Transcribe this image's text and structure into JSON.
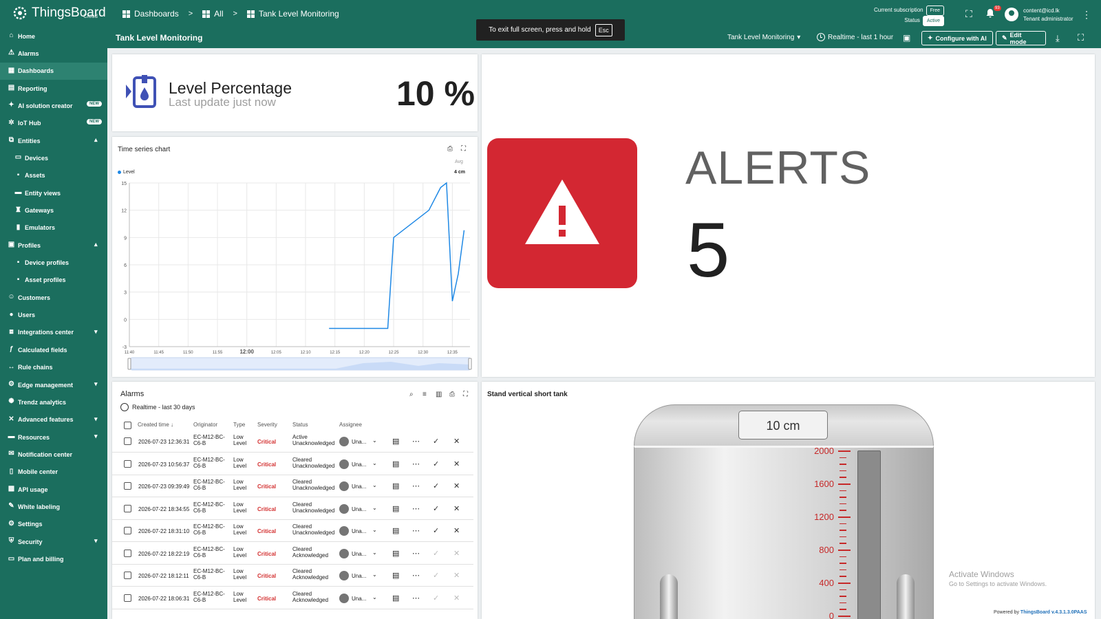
{
  "app": {
    "name": "ThingsBoard",
    "edition": "Cloud"
  },
  "breadcrumb": [
    "Dashboards",
    "All",
    "Tank Level Monitoring"
  ],
  "page_title": "Tank Level Monitoring",
  "fullscreen_hint": {
    "text": "To exit full screen, press and hold",
    "key": "Esc"
  },
  "subscription": {
    "label": "Current subscription",
    "plan": "Free",
    "status_label": "Status",
    "status": "Active"
  },
  "notifications": {
    "count": "93"
  },
  "user": {
    "email": "content@icd.lk",
    "role": "Tenant administrator"
  },
  "toolbar": {
    "dashboard_select": "Tank Level Monitoring",
    "timewindow": "Realtime - last 1 hour",
    "configure_ai": "Configure with AI",
    "edit_mode": "Edit mode"
  },
  "sidebar": {
    "items": [
      {
        "label": "Home",
        "icon": "home-icon"
      },
      {
        "label": "Alarms",
        "icon": "alarm-icon"
      },
      {
        "label": "Dashboards",
        "icon": "dashboard-icon",
        "selected": true
      },
      {
        "label": "Reporting",
        "icon": "report-icon"
      },
      {
        "label": "AI solution creator",
        "icon": "ai-icon",
        "badge": "NEW"
      },
      {
        "label": "IoT Hub",
        "icon": "hub-icon",
        "badge": "NEW"
      },
      {
        "label": "Entities",
        "icon": "entities-icon",
        "expanded": true
      },
      {
        "label": "Devices",
        "icon": "device-icon",
        "child": true
      },
      {
        "label": "Assets",
        "icon": "asset-icon",
        "child": true
      },
      {
        "label": "Entity views",
        "icon": "view-icon",
        "child": true
      },
      {
        "label": "Gateways",
        "icon": "gateway-icon",
        "child": true
      },
      {
        "label": "Emulators",
        "icon": "emulator-icon",
        "child": true
      },
      {
        "label": "Profiles",
        "icon": "profiles-icon",
        "expanded": true
      },
      {
        "label": "Device profiles",
        "icon": "device-profile-icon",
        "child": true
      },
      {
        "label": "Asset profiles",
        "icon": "asset-profile-icon",
        "child": true
      },
      {
        "label": "Customers",
        "icon": "customers-icon"
      },
      {
        "label": "Users",
        "icon": "users-icon"
      },
      {
        "label": "Integrations center",
        "icon": "integrations-icon",
        "collapsed": true
      },
      {
        "label": "Calculated fields",
        "icon": "function-icon"
      },
      {
        "label": "Rule chains",
        "icon": "rule-chain-icon"
      },
      {
        "label": "Edge management",
        "icon": "edge-icon",
        "collapsed": true
      },
      {
        "label": "Trendz analytics",
        "icon": "trendz-icon"
      },
      {
        "label": "Advanced features",
        "icon": "tools-icon",
        "collapsed": true
      },
      {
        "label": "Resources",
        "icon": "folder-icon",
        "collapsed": true
      },
      {
        "label": "Notification center",
        "icon": "inbox-icon"
      },
      {
        "label": "Mobile center",
        "icon": "mobile-icon"
      },
      {
        "label": "API usage",
        "icon": "api-icon"
      },
      {
        "label": "White labeling",
        "icon": "brush-icon"
      },
      {
        "label": "Settings",
        "icon": "settings-icon"
      },
      {
        "label": "Security",
        "icon": "security-icon",
        "collapsed": true
      },
      {
        "label": "Plan and billing",
        "icon": "billing-icon"
      }
    ]
  },
  "level_widget": {
    "title": "Level Percentage",
    "subtitle": "Last update just now",
    "value": "10 %"
  },
  "chart_widget": {
    "title": "Time series chart",
    "legend_name": "Level",
    "avg_label": "Avg",
    "avg_value": "4 cm"
  },
  "chart_data": {
    "type": "line",
    "title": "",
    "series": [
      {
        "name": "Level",
        "points": [
          [
            "12:14",
            -1
          ],
          [
            "12:24",
            -1
          ],
          [
            "12:25",
            9
          ],
          [
            "12:31",
            12
          ],
          [
            "12:33",
            14.5
          ],
          [
            "12:34",
            15
          ],
          [
            "12:35",
            2
          ],
          [
            "12:36",
            5
          ],
          [
            "12:37",
            9.8
          ]
        ]
      }
    ],
    "x_ticks": [
      "11:40",
      "11:45",
      "11:50",
      "11:55",
      "12:00",
      "12:05",
      "12:10",
      "12:15",
      "12:20",
      "12:25",
      "12:30",
      "12:35"
    ],
    "x_range": [
      "11:40",
      "12:38"
    ],
    "ylim": [
      -3,
      15
    ],
    "y_ticks": [
      "15",
      "12",
      "9",
      "6",
      "3",
      "0",
      "-3"
    ],
    "grid": true,
    "legend_position": "top-left"
  },
  "alerts_widget": {
    "label": "ALERTS",
    "count": "5"
  },
  "alarms_widget": {
    "title": "Alarms",
    "range": "Realtime - last 30 days",
    "columns": [
      "Created time",
      "Originator",
      "Type",
      "Severity",
      "Status",
      "Assignee"
    ],
    "rows": [
      {
        "time": "2026-07-23 12:36:31",
        "originator": [
          "EC-M12-BC-",
          "C6-B"
        ],
        "type": [
          "Low",
          "Level"
        ],
        "severity": "Critical",
        "status": [
          "Active",
          "Unacknowledged"
        ],
        "assignee": "Una...",
        "ack_enabled": true
      },
      {
        "time": "2026-07-23 10:56:37",
        "originator": [
          "EC-M12-BC-",
          "C6-B"
        ],
        "type": [
          "Low",
          "Level"
        ],
        "severity": "Critical",
        "status": [
          "Cleared",
          "Unacknowledged"
        ],
        "assignee": "Una...",
        "ack_enabled": true
      },
      {
        "time": "2026-07-23 09:39:49",
        "originator": [
          "EC-M12-BC-",
          "C6-B"
        ],
        "type": [
          "Low",
          "Level"
        ],
        "severity": "Critical",
        "status": [
          "Cleared",
          "Unacknowledged"
        ],
        "assignee": "Una...",
        "ack_enabled": true
      },
      {
        "time": "2026-07-22 18:34:55",
        "originator": [
          "EC-M12-BC-",
          "C6-B"
        ],
        "type": [
          "Low",
          "Level"
        ],
        "severity": "Critical",
        "status": [
          "Cleared",
          "Unacknowledged"
        ],
        "assignee": "Una...",
        "ack_enabled": true
      },
      {
        "time": "2026-07-22 18:31:10",
        "originator": [
          "EC-M12-BC-",
          "C6-B"
        ],
        "type": [
          "Low",
          "Level"
        ],
        "severity": "Critical",
        "status": [
          "Cleared",
          "Unacknowledged"
        ],
        "assignee": "Una...",
        "ack_enabled": true
      },
      {
        "time": "2026-07-22 18:22:19",
        "originator": [
          "EC-M12-BC-",
          "C6-B"
        ],
        "type": [
          "Low",
          "Level"
        ],
        "severity": "Critical",
        "status": [
          "Cleared",
          "Acknowledged"
        ],
        "assignee": "Una...",
        "ack_enabled": false
      },
      {
        "time": "2026-07-22 18:12:11",
        "originator": [
          "EC-M12-BC-",
          "C6-B"
        ],
        "type": [
          "Low",
          "Level"
        ],
        "severity": "Critical",
        "status": [
          "Cleared",
          "Acknowledged"
        ],
        "assignee": "Una...",
        "ack_enabled": false
      },
      {
        "time": "2026-07-22 18:06:31",
        "originator": [
          "EC-M12-BC-",
          "C6-B"
        ],
        "type": [
          "Low",
          "Level"
        ],
        "severity": "Critical",
        "status": [
          "Cleared",
          "Acknowledged"
        ],
        "assignee": "Una...",
        "ack_enabled": false
      }
    ]
  },
  "tank_widget": {
    "title": "Stand vertical short tank",
    "value_label": "10 cm",
    "scale": [
      "2000",
      "1600",
      "1200",
      "800",
      "400",
      "0"
    ]
  },
  "windows_watermark": {
    "title": "Activate Windows",
    "subtitle": "Go to Settings to activate Windows."
  },
  "footer": {
    "powered_prefix": "Powered by",
    "powered_link": "ThingsBoard v.4.3.1.3.0PAAS"
  },
  "colors": {
    "brand": "#1b6e5e",
    "brand_selected": "#2d8271",
    "critical": "#d32f2f",
    "alert_box": "#d32732",
    "series": "#1e88e5"
  }
}
